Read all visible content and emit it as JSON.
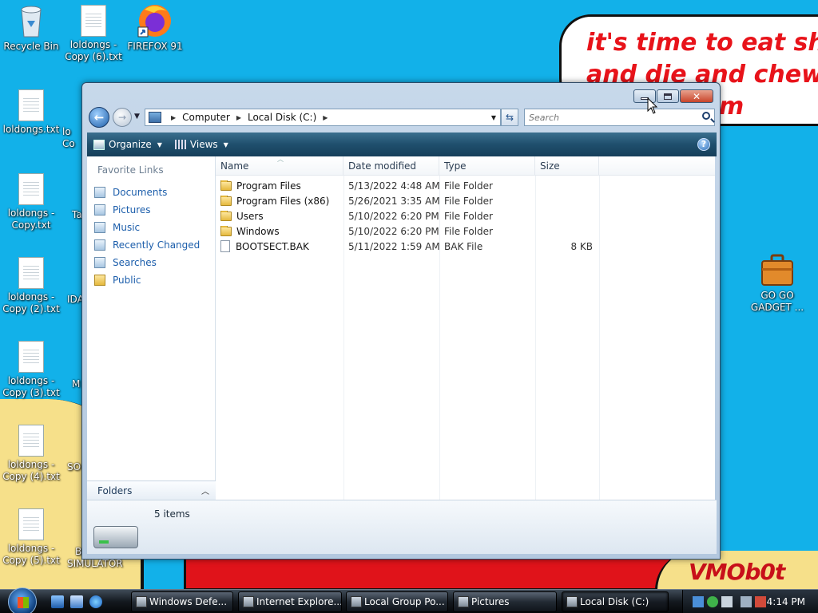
{
  "desktop": {
    "speech_text_line1": "it's time to eat shit",
    "speech_text_line2": "and die and chew",
    "speech_text_line3": "m",
    "watermark": "VMOb0t",
    "icons": [
      {
        "label": "Recycle Bin",
        "icon": "recycle-bin-icon"
      },
      {
        "label": "loldongs - Copy (6).txt",
        "icon": "text-file-icon"
      },
      {
        "label": "FIREFOX 91",
        "icon": "firefox-icon"
      },
      {
        "label": "loldongs.txt",
        "icon": "text-file-icon"
      },
      {
        "label": "loldongs - Copy.txt",
        "icon": "text-file-icon"
      },
      {
        "label": "loldongs - Copy (2).txt",
        "icon": "text-file-icon"
      },
      {
        "label": "loldongs - Copy (3).txt",
        "icon": "text-file-icon"
      },
      {
        "label": "loldongs - Copy (4).txt",
        "icon": "text-file-icon"
      },
      {
        "label": "loldongs - Copy (5).txt",
        "icon": "text-file-icon"
      },
      {
        "label": "GO GO GADGET ...",
        "icon": "briefcase-icon"
      }
    ],
    "partial_labels": [
      "lo",
      "Co",
      "Ta",
      "IDA",
      "M",
      "SO",
      "B",
      "SIMULATOR"
    ]
  },
  "window": {
    "nav": {
      "breadcrumb": [
        "Computer",
        "Local Disk (C:)"
      ],
      "search_placeholder": "Search"
    },
    "toolbar": {
      "organize_label": "Organize",
      "views_label": "Views"
    },
    "favorite_links_title": "Favorite Links",
    "favorite_links": [
      "Documents",
      "Pictures",
      "Music",
      "Recently Changed",
      "Searches",
      "Public"
    ],
    "folders_label": "Folders",
    "columns": [
      "Name",
      "Date modified",
      "Type",
      "Size"
    ],
    "files": [
      {
        "name": "Program Files",
        "date": "5/13/2022 4:48 AM",
        "type": "File Folder",
        "size": "",
        "icon": "folder-icon"
      },
      {
        "name": "Program Files (x86)",
        "date": "5/26/2021 3:35 AM",
        "type": "File Folder",
        "size": "",
        "icon": "folder-icon"
      },
      {
        "name": "Users",
        "date": "5/10/2022 6:20 PM",
        "type": "File Folder",
        "size": "",
        "icon": "folder-icon"
      },
      {
        "name": "Windows",
        "date": "5/10/2022 6:20 PM",
        "type": "File Folder",
        "size": "",
        "icon": "folder-icon"
      },
      {
        "name": "BOOTSECT.BAK",
        "date": "5/11/2022 1:59 AM",
        "type": "BAK File",
        "size": "8 KB",
        "icon": "file-icon"
      }
    ],
    "status": "5 items"
  },
  "taskbar": {
    "buttons": [
      {
        "label": "Windows Defe..."
      },
      {
        "label": "Internet Explore..."
      },
      {
        "label": "Local Group Po..."
      },
      {
        "label": "Pictures"
      },
      {
        "label": "Local Disk (C:)"
      }
    ],
    "clock": "4:14 PM"
  },
  "colors": {
    "desktop_bg": "#12b1e9",
    "speech_text": "#e8131a",
    "link_blue": "#1c5eab",
    "toolbar_dark": "#1f4f6d"
  }
}
